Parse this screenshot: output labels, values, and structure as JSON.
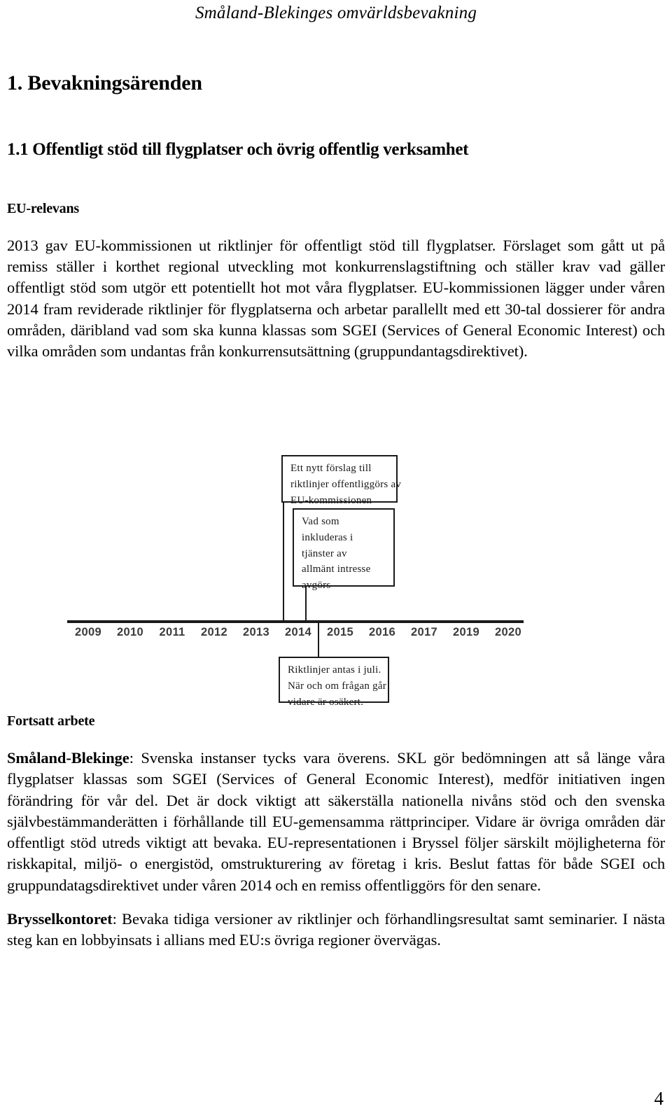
{
  "document": {
    "running_header": "Småland-Blekinges omvärldsbevakning",
    "page_number": "4"
  },
  "headings": {
    "chapter": "1. Bevakningsärenden",
    "section": "1.1 Offentligt stöd till flygplatser och övrig offentlig verksamhet",
    "eu_relevance": "EU-relevans",
    "further_work": "Fortsatt arbete"
  },
  "paragraphs": {
    "eu_relevance_body": "2013 gav EU-kommissionen ut riktlinjer för offentligt stöd till flygplatser. Förslaget som gått ut på remiss ställer i korthet regional utveckling mot konkurrenslagstiftning och ställer krav vad gäller offentligt stöd som utgör ett potentiellt hot mot våra flygplatser. EU-kommissionen lägger under våren 2014 fram reviderade riktlinjer för flygplatserna och arbetar parallellt med ett 30-tal dossierer för andra områden, däribland vad som ska kunna klassas som SGEI (Services of General Economic Interest) och vilka områden som undantas från konkurrensutsättning (gruppundantagsdirektivet).",
    "smaland_lead": "Småland-Blekinge",
    "smaland_body": ": Svenska instanser tycks vara överens. SKL gör bedömningen att så länge våra flygplatser klassas som SGEI (Services of General Economic Interest), medför initiativen ingen förändring för vår del. Det är dock viktigt att säkerställa nationella nivåns stöd och den svenska självbestämmanderätten i förhållande till EU-gemensamma rättprinciper. Vidare är övriga områden där offentligt stöd utreds viktigt att bevaka. EU-representationen i Bryssel följer särskilt möjligheterna för riskkapital, miljö- o energistöd, omstrukturering av företag i kris.  Beslut fattas för både SGEI och gruppundatagsdirektivet under våren 2014 och en remiss offentliggörs för den senare.",
    "brussels_lead": "Brysselkontoret",
    "brussels_body": ": Bevaka tidiga versioner av riktlinjer och förhandlingsresultat samt seminarier. I nästa steg kan en lobbyinsats i allians med EU:s övriga regioner övervägas."
  },
  "chart_data": {
    "type": "timeline",
    "title": "",
    "axis_label": "",
    "categories": [
      "2009",
      "2010",
      "2011",
      "2012",
      "2013",
      "2014",
      "2015",
      "2016",
      "2017",
      "2019",
      "2020"
    ],
    "annotations": [
      {
        "id": "proposal",
        "position": "2013-2014",
        "placement": "above",
        "lines": [
          "Ett nytt förslag till",
          "riktlinjer offentliggörs av",
          "EU-kommissionen"
        ]
      },
      {
        "id": "services",
        "position": "2014",
        "placement": "above",
        "lines": [
          "Vad som",
          "inkluderas i",
          "tjänster av",
          "allmänt intresse",
          "avgörs"
        ]
      },
      {
        "id": "adopted",
        "position": "2014",
        "placement": "below",
        "lines": [
          "Riktlinjer antas i juli.",
          "När och om frågan går",
          "vidare är osäkert."
        ]
      }
    ],
    "colors": {
      "axis": "#1a1a1a",
      "box_border": "#1a1a1a",
      "year_label": "#3b3b3b"
    }
  }
}
